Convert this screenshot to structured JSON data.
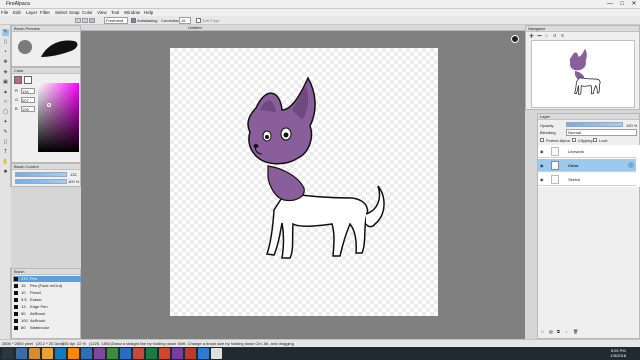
{
  "app": {
    "title": "FireAlpaca",
    "window_controls": {
      "minimize": "—",
      "maximize": "□",
      "close": "✕"
    }
  },
  "menu": [
    "File",
    "Edit",
    "Layer",
    "Filter",
    "Select",
    "Snap",
    "Color",
    "View",
    "Tool",
    "Window",
    "Help"
  ],
  "toolbar": {
    "mode_select": "Freehand",
    "antialias_label": "Antialiasing",
    "correction_label": "Correction",
    "correction_value": "15",
    "softedge_label": "Soft Edge"
  },
  "document": {
    "tab_label": "Untitled"
  },
  "brush_preview": {
    "title": "Brush Preview"
  },
  "color_panel": {
    "title": "Color",
    "fg_color": "#b86a85",
    "fields": [
      {
        "label": "R",
        "value": "134"
      },
      {
        "label": "G",
        "value": "007"
      },
      {
        "label": "B",
        "value": "105"
      }
    ]
  },
  "brush_control": {
    "title": "Brush Control",
    "size_value": "132",
    "opacity_value": "100 %"
  },
  "brush_list": {
    "title": "Brush",
    "items": [
      {
        "num": "172",
        "name": "Pen",
        "selected": true
      },
      {
        "num": "15",
        "name": "Pen (Fade In/Out)",
        "selected": false
      },
      {
        "num": "10",
        "name": "Pencil",
        "selected": false
      },
      {
        "num": "9.5",
        "name": "Eraser",
        "selected": false
      },
      {
        "num": "13",
        "name": "Edge Pen",
        "selected": false
      },
      {
        "num": "50",
        "name": "AirBrush",
        "selected": false
      },
      {
        "num": "100",
        "name": "AirBrush",
        "selected": false
      },
      {
        "num": "80",
        "name": "Watercolor",
        "selected": false
      }
    ]
  },
  "navigator": {
    "title": "Navigator"
  },
  "layer_panel": {
    "title": "Layer",
    "opacity_label": "Opacity",
    "opacity_value": "100 %",
    "blending_label": "Blending",
    "blending_value": "Normal",
    "protect_alpha": "Protect Alpha",
    "clipping": "Clipping",
    "lock": "Lock",
    "layers": [
      {
        "name": "Linework",
        "selected": false
      },
      {
        "name": "Color",
        "selected": true
      },
      {
        "name": "Sketch",
        "selected": false
      }
    ]
  },
  "statusbar": {
    "size": "2800 * 2800 pixel",
    "dims": "(20.2 * 20.3cm)",
    "dpi": "350 dpi",
    "zoom": "22 %",
    "coords": "(1225, 1892)",
    "hint": "Draw a straight line by holding down Shift, Change a brush size by holding down Ctrl, Alt, and dragging"
  },
  "taskbar": {
    "time": "5:03 PM",
    "date": "1/5/2018"
  }
}
